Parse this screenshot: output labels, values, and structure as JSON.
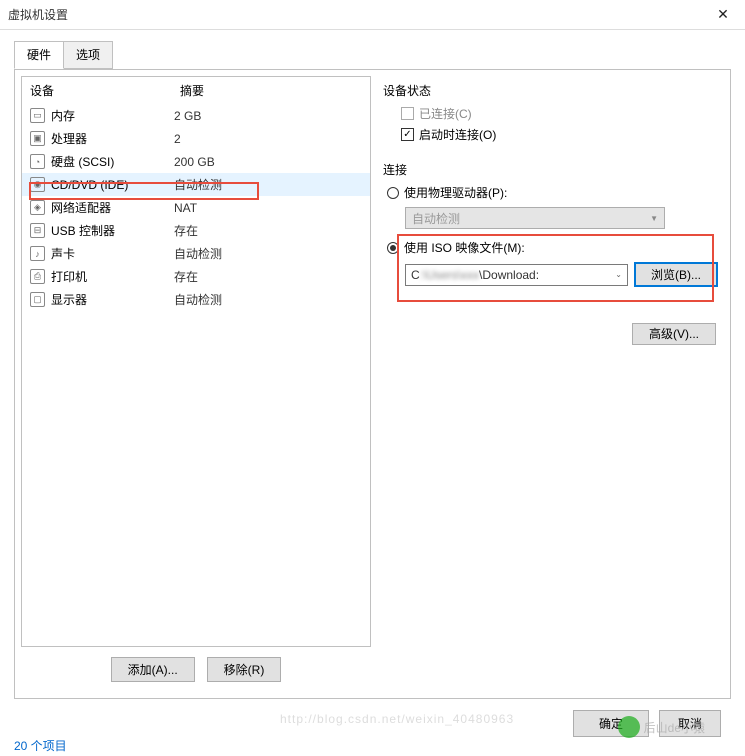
{
  "window": {
    "title": "虚拟机设置",
    "close": "✕"
  },
  "tabs": {
    "hardware": "硬件",
    "options": "选项"
  },
  "device_table": {
    "col_device": "设备",
    "col_summary": "摘要",
    "rows": [
      {
        "icon": "ic-mem",
        "name": "内存",
        "summary": "2 GB"
      },
      {
        "icon": "ic-cpu",
        "name": "处理器",
        "summary": "2"
      },
      {
        "icon": "ic-hdd",
        "name": "硬盘 (SCSI)",
        "summary": "200 GB"
      },
      {
        "icon": "ic-cd",
        "name": "CD/DVD (IDE)",
        "summary": "自动检测",
        "selected": true
      },
      {
        "icon": "ic-net",
        "name": "网络适配器",
        "summary": "NAT"
      },
      {
        "icon": "ic-usb",
        "name": "USB 控制器",
        "summary": "存在"
      },
      {
        "icon": "ic-snd",
        "name": "声卡",
        "summary": "自动检测"
      },
      {
        "icon": "ic-prn",
        "name": "打印机",
        "summary": "存在"
      },
      {
        "icon": "ic-dsp",
        "name": "显示器",
        "summary": "自动检测"
      }
    ]
  },
  "buttons": {
    "add": "添加(A)...",
    "remove": "移除(R)",
    "browse": "浏览(B)...",
    "advanced": "高级(V)...",
    "ok": "确定",
    "cancel": "取消",
    "help": ""
  },
  "device_status": {
    "title": "设备状态",
    "connected": "已连接(C)",
    "connect_at_power": "启动时连接(O)"
  },
  "connection": {
    "title": "连接",
    "use_physical": "使用物理驱动器(P):",
    "auto_detect": "自动检测",
    "use_iso": "使用 ISO 映像文件(M):",
    "iso_path_prefix": "C",
    "iso_path_suffix": "\\Download:"
  },
  "watermark": "后山de小猿",
  "bg_url": "http://blog.csdn.net/weixin_40480963",
  "items_count": "20 个项目"
}
